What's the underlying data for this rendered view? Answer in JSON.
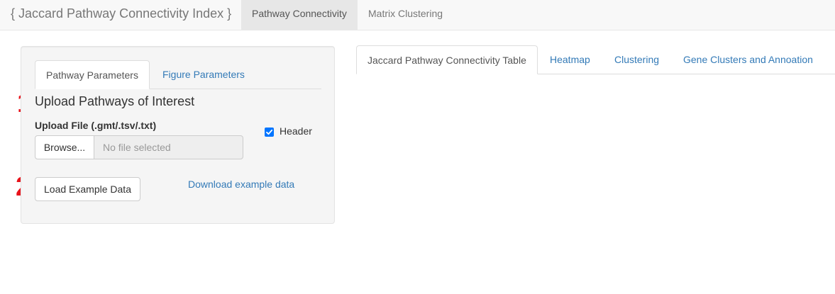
{
  "navbar": {
    "brand": "{ Jaccard Pathway Connectivity Index }",
    "items": [
      {
        "label": "Pathway Connectivity",
        "active": true
      },
      {
        "label": "Matrix Clustering",
        "active": false
      }
    ]
  },
  "sidebar": {
    "tabs": [
      {
        "label": "Pathway Parameters",
        "active": true
      },
      {
        "label": "Figure Parameters",
        "active": false
      }
    ],
    "section_title": "Upload Pathways of Interest",
    "upload_label": "Upload File (.gmt/.tsv/.txt)",
    "browse_label": "Browse...",
    "file_placeholder": "No file selected",
    "header_checkbox": {
      "label": "Header",
      "checked": true
    },
    "load_example_label": "Load Example Data",
    "download_example_label": "Download example data"
  },
  "annotations": {
    "step1": "1",
    "step2": "2"
  },
  "main": {
    "tabs": [
      {
        "label": "Jaccard Pathway Connectivity Table",
        "active": true
      },
      {
        "label": "Heatmap",
        "active": false
      },
      {
        "label": "Clustering",
        "active": false
      },
      {
        "label": "Gene Clusters and Annoation",
        "active": false
      }
    ]
  },
  "colors": {
    "link": "#337ab7",
    "annotation_red": "#e8141c",
    "checkbox_blue": "#0075ff",
    "navbar_bg": "#f8f8f8",
    "well_bg": "#f5f5f5"
  }
}
